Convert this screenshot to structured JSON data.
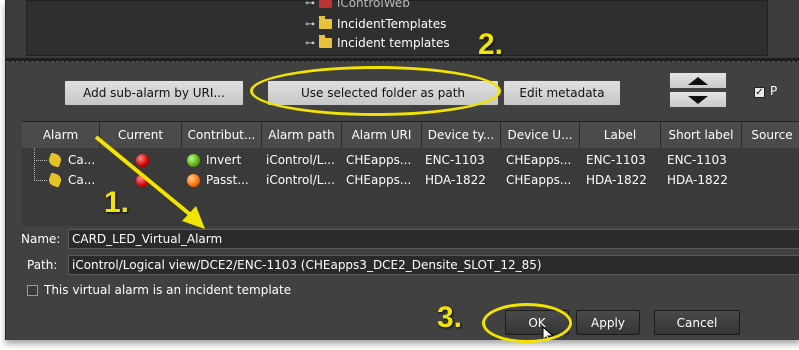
{
  "tree": {
    "items": [
      {
        "label": "iControlWeb"
      },
      {
        "label": "IncidentTemplates"
      },
      {
        "label": "Incident templates"
      }
    ]
  },
  "toolbar": {
    "add_sub_alarm_label": "Add sub-alarm by URI...",
    "use_selected_folder_label": "Use selected folder as path",
    "edit_metadata_label": "Edit metadata",
    "move_up_icon": "triangle-up-icon",
    "move_down_icon": "triangle-down-icon",
    "right_checkbox_label": "P",
    "right_checkbox_checked": true
  },
  "grid": {
    "columns": [
      "Alarm",
      "Current",
      "Contribut...",
      "Alarm path",
      "Alarm URI",
      "Device ty...",
      "Device U...",
      "Label",
      "Short label",
      "Source"
    ],
    "rows": [
      {
        "alarm": "Ca...",
        "current": "red",
        "contribution_state": "green",
        "contribution": "Invert",
        "alarm_path": "iControl/L...",
        "alarm_uri": "CHEapps...",
        "device_type": "ENC-1103",
        "device_uri": "CHEapps...",
        "label": "ENC-1103",
        "short_label": "ENC-1103",
        "source": ""
      },
      {
        "alarm": "Ca...",
        "current": "red",
        "contribution_state": "orange",
        "contribution": "Passt...",
        "alarm_path": "iControl/L...",
        "alarm_uri": "CHEapps...",
        "device_type": "HDA-1822",
        "device_uri": "CHEapps...",
        "label": "HDA-1822",
        "short_label": "HDA-1822",
        "source": ""
      }
    ]
  },
  "form": {
    "name_label": "Name:",
    "name_value": "CARD_LED_Virtual_Alarm",
    "path_label": "Path:",
    "path_value": "iControl/Logical view/DCE2/ENC-1103 (CHEapps3_DCE2_Densite_SLOT_12_85)",
    "incident_template_label": "This virtual alarm is an incident template",
    "incident_template_checked": false
  },
  "buttons": {
    "ok_label": "OK",
    "apply_label": "Apply",
    "cancel_label": "Cancel"
  },
  "callouts": {
    "step1": "1.",
    "step2": "2.",
    "step3": "3."
  },
  "colors": {
    "callout": "#f2e300",
    "status_red": "#d20000",
    "status_green": "#5aa80a",
    "status_orange": "#ff6a00"
  }
}
